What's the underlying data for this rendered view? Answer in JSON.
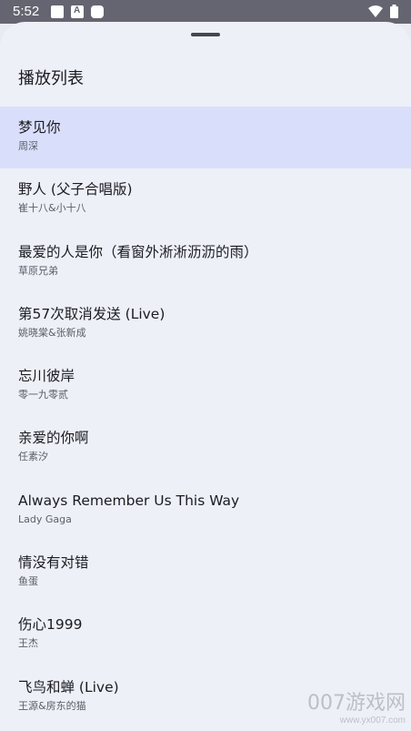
{
  "status_bar": {
    "time": "5:52",
    "colors": {
      "background": "#646570",
      "foreground": "#ffffff"
    },
    "icons": [
      "notification-square-icon",
      "notification-a-icon",
      "notification-rounded-icon",
      "wifi-icon",
      "battery-icon"
    ]
  },
  "sheet": {
    "title": "播放列表",
    "colors": {
      "background": "#eef0f8",
      "active_row": "#d9dffa"
    }
  },
  "tracks": [
    {
      "title": "梦见你",
      "artist": "周深",
      "active": true
    },
    {
      "title": "野人 (父子合唱版)",
      "artist": "崔十八&小十八",
      "active": false
    },
    {
      "title": "最爱的人是你（看窗外淅淅沥沥的雨）",
      "artist": "草原兄弟",
      "active": false
    },
    {
      "title": "第57次取消发送 (Live)",
      "artist": "姚晓棠&张新成",
      "active": false
    },
    {
      "title": "忘川彼岸",
      "artist": "零一九零贰",
      "active": false
    },
    {
      "title": "亲爱的你啊",
      "artist": "任素汐",
      "active": false
    },
    {
      "title": "Always Remember Us This Way",
      "artist": "Lady Gaga",
      "active": false
    },
    {
      "title": "情没有对错",
      "artist": "鱼蛋",
      "active": false
    },
    {
      "title": "伤心1999",
      "artist": "王杰",
      "active": false
    },
    {
      "title": "飞鸟和蝉 (Live)",
      "artist": "王源&房东的猫",
      "active": false
    }
  ],
  "watermark": {
    "main": "007游戏网",
    "url": "www.yx007.com"
  }
}
